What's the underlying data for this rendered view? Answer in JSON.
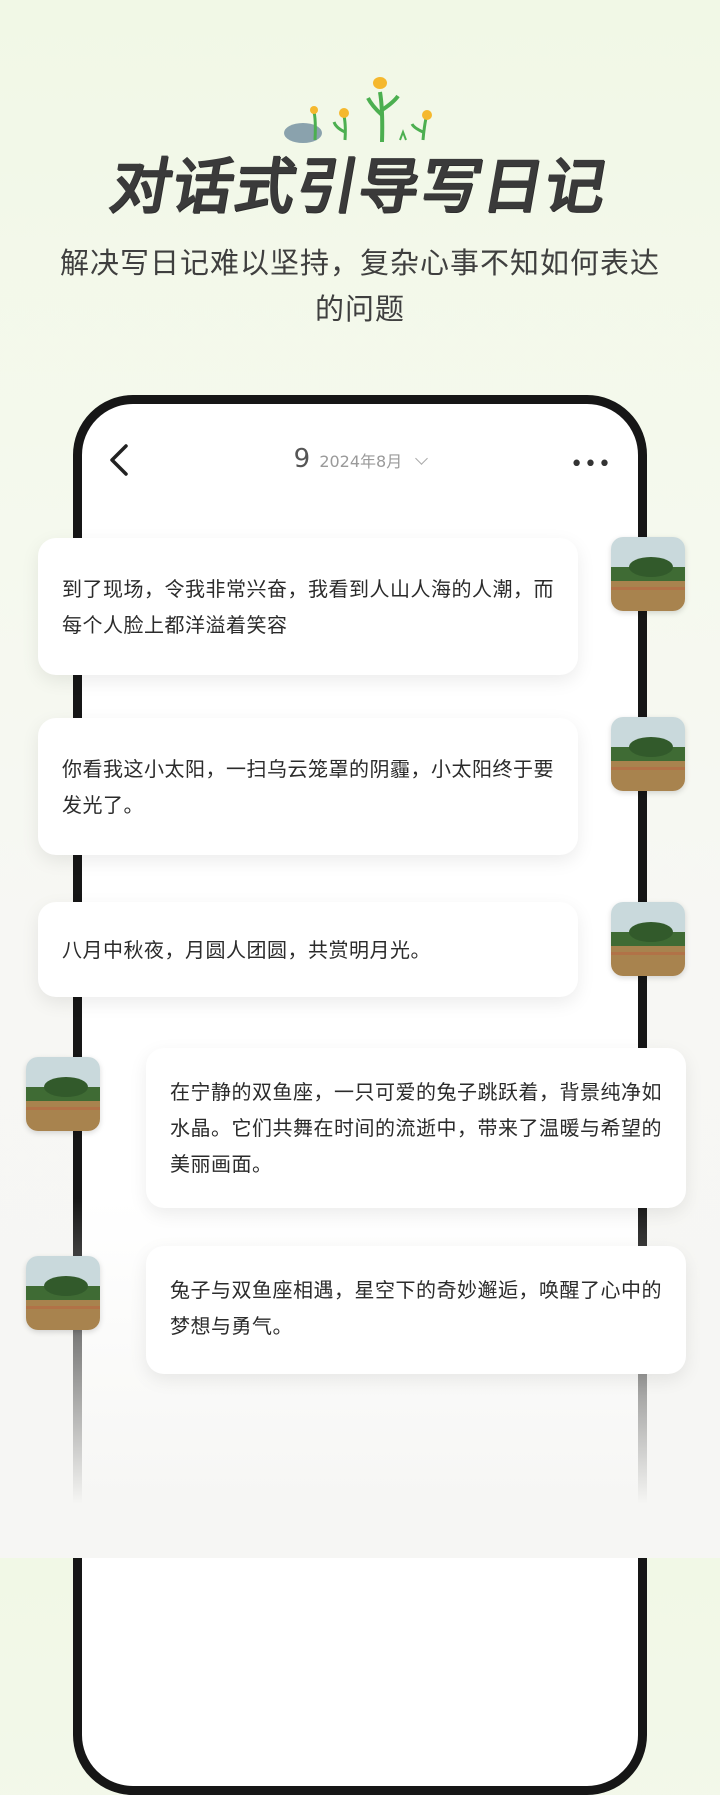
{
  "header": {
    "headline": "对话式引导写日记",
    "subtitle": "解决写日记难以坚持，复杂心事不知如何表达的问题"
  },
  "phone": {
    "day": "9",
    "month": "2024年8月",
    "icons": {
      "back": "back-chevron-icon",
      "date_dropdown": "chevron-down-icon",
      "more": "more-dots-icon"
    }
  },
  "messages": [
    {
      "side": "left",
      "text": "到了现场，令我非常兴奋，我看到人山人海的人潮，而每个人脸上都洋溢着笑容"
    },
    {
      "side": "left",
      "text": "你看我这小太阳，一扫乌云笼罩的阴霾，小太阳终于要发光了。"
    },
    {
      "side": "left",
      "text": "八月中秋夜，月圆人团圆，共赏明月光。"
    },
    {
      "side": "right",
      "text": "在宁静的双鱼座，一只可爱的兔子跳跃着，背景纯净如水晶。它们共舞在时间的流逝中，带来了温暖与希望的美丽画面。"
    },
    {
      "side": "right",
      "text": "兔子与双鱼座相遇，星空下的奇妙邂逅，唤醒了心中的梦想与勇气。"
    }
  ],
  "colors": {
    "headline": "#3a3a3a",
    "frame": "#161616",
    "flower": "#f5b82e",
    "leaf": "#4caf50"
  }
}
